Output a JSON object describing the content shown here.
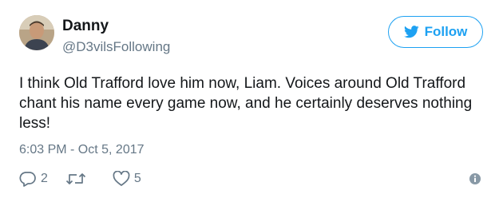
{
  "user": {
    "name": "Danny",
    "handle": "@D3vilsFollowing"
  },
  "follow_button": {
    "label": "Follow",
    "icon": "twitter-bird-icon"
  },
  "tweet": {
    "text": "I think Old Trafford love him now, Liam. Voices around Old Trafford chant his name every game now, and he certainly deserves nothing less!",
    "timestamp": "6:03 PM - Oct 5, 2017"
  },
  "actions": {
    "reply_count": "2",
    "retweet_count": "",
    "like_count": "5"
  },
  "colors": {
    "accent": "#1da1f2",
    "text": "#14171a",
    "secondary": "#657786"
  }
}
